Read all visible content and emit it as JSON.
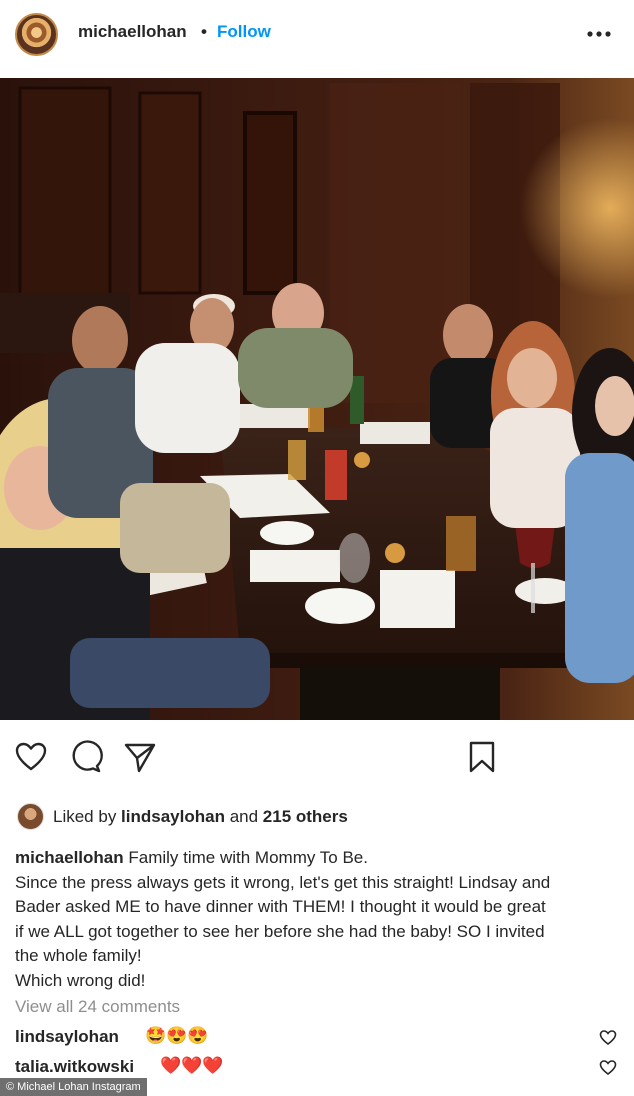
{
  "header": {
    "username": "michaellohan",
    "separator": "•",
    "follow_label": "Follow",
    "more_icon": "more-horizontal-icon"
  },
  "post": {
    "photo": "group-dinner-photo"
  },
  "actions": {
    "like_icon": "heart-icon",
    "comment_icon": "comment-icon",
    "share_icon": "send-icon",
    "save_icon": "bookmark-icon"
  },
  "likes": {
    "prefix": "Liked by ",
    "user": "lindsaylohan",
    "middle": " and ",
    "count": "215 others"
  },
  "caption": {
    "user": "michaellohan",
    "lines": [
      " Family time with Mommy To Be.",
      "Since the press always gets it wrong, let's get this straight! Lindsay and",
      "Bader asked ME to have dinner with THEM! I thought it would be great",
      "if we ALL got together to see her before she had the baby! SO I invited",
      "the whole family!",
      "Which wrong did!"
    ]
  },
  "comments": {
    "view_all": "View all 24 comments",
    "items": [
      {
        "user": "lindsaylohan",
        "emoji": "🤩😍😍"
      },
      {
        "user": "talia.witkowski",
        "emoji": "❤️❤️❤️"
      }
    ]
  },
  "credit": "© Michael Lohan Instagram",
  "colors": {
    "follow": "#0095f6",
    "text": "#262626",
    "muted": "#8e8e8e",
    "paneling": "#3b1a10"
  }
}
